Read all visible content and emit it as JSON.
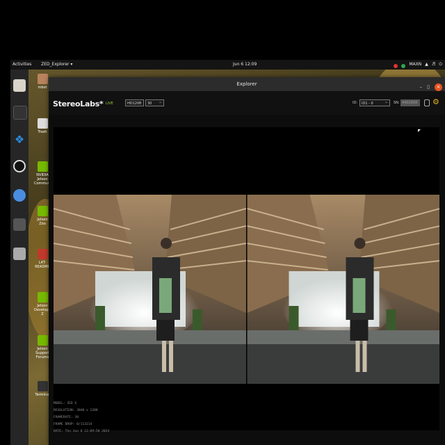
{
  "topbar": {
    "activities": "Activities",
    "app_menu": "ZED_Explorer ▾",
    "clock": "Jun 6 12:09",
    "power_mode": "MAXN"
  },
  "dock": {
    "items": [
      "files-icon",
      "terminal-icon",
      "vscode-icon",
      "obs-icon",
      "chromium-icon",
      "app-icon",
      "drive-icon"
    ]
  },
  "desktop": {
    "icons": [
      {
        "label": "mbot",
        "name": "desktop-icon-mbot"
      },
      {
        "label": "Trash",
        "name": "desktop-icon-trash"
      },
      {
        "label": "NVIDIA Jetson Community",
        "name": "desktop-icon-nvidia-community"
      },
      {
        "label": "Jetson Zoo",
        "name": "desktop-icon-jetson-zoo"
      },
      {
        "label": "L4T-README",
        "name": "desktop-icon-l4t-readme"
      },
      {
        "label": "Jetson Developer Z",
        "name": "desktop-icon-jetson-developer"
      },
      {
        "label": "Jetson Support Forums",
        "name": "desktop-icon-jetson-support"
      },
      {
        "label": "Terminal",
        "name": "desktop-icon-terminal"
      }
    ]
  },
  "window": {
    "title": "Explorer",
    "min": "–",
    "max": "▯",
    "close": "×"
  },
  "app": {
    "logo": "StereoLabs*",
    "live": "LIVE",
    "resolution": "HD1200",
    "fps": "30",
    "id_label": "ID:",
    "id_value": "ID1 - 0",
    "sn_label": "SN:",
    "sn_value": "4402808"
  },
  "info": {
    "model": "MODEL: ZED X",
    "resolution": "RESOLUTION: 3840 x 1200",
    "framerate": "FRAMERATE: 30",
    "frame_drop": "FRAME DROP: 0/113214",
    "date": "DATE: Thu Jun 6 12:09:50 2024"
  }
}
